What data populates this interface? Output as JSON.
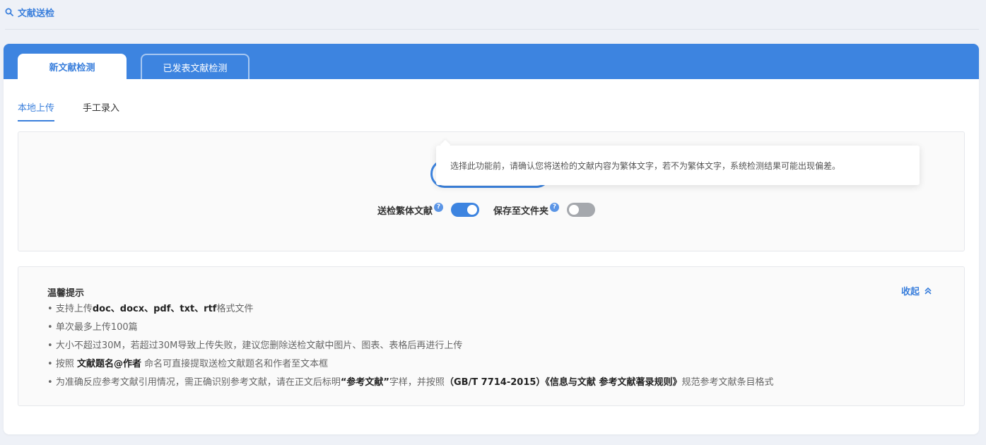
{
  "header": {
    "title": "文献送检",
    "icon": "search-icon"
  },
  "tabs": [
    {
      "label": "新文献检测",
      "active": true
    },
    {
      "label": "已发表文献检测",
      "active": false
    }
  ],
  "subtabs": [
    {
      "label": "本地上传",
      "active": true
    },
    {
      "label": "手工录入",
      "active": false
    }
  ],
  "tooltip": {
    "text": "选择此功能前，请确认您将送检的文献内容为繁体文字，若不为繁体文字，系统检测结果可能出现偏差。"
  },
  "options": {
    "traditional": {
      "label": "送检繁体文献",
      "help": "?",
      "enabled": true
    },
    "save_folder": {
      "label": "保存至文件夹",
      "help": "?",
      "enabled": false
    }
  },
  "tips": {
    "title": "温馨提示",
    "collapse_label": "收起",
    "item1": {
      "pre": "支持上传",
      "bold": "doc、docx、pdf、txt、rtf",
      "post": "格式文件"
    },
    "item2": "单次最多上传100篇",
    "item3": "大小不超过30M，若超过30M导致上传失败，建议您删除送检文献中图片、图表、表格后再进行上传",
    "item4": {
      "pre": "按照 ",
      "bold": "文献题名@作者",
      "post": " 命名可直接提取送检文献题名和作者至文本框"
    },
    "item5": {
      "pre": "为准确反应参考文献引用情况，需正确识别参考文献，请在正文后标明",
      "bold1": "“参考文献”",
      "mid": "字样，并按照",
      "bold2": "（GB/T 7714-2015）《信息与文献 参考文献著录规则》",
      "post": "规范参考文献条目格式"
    }
  },
  "colors": {
    "accent": "#3d84e0",
    "toggle_off": "#a5a8ad"
  }
}
